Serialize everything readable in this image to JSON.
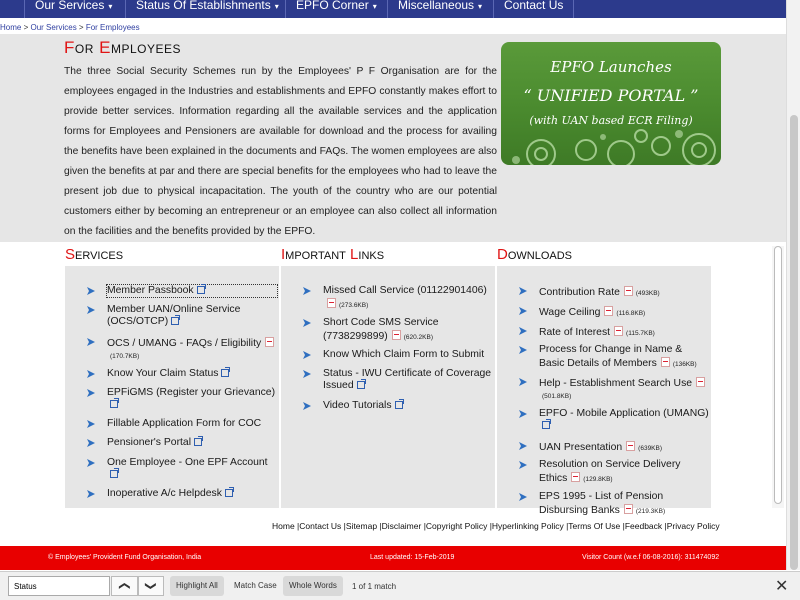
{
  "nav": {
    "items": [
      {
        "label": "Our Services",
        "caret": "▾"
      },
      {
        "label": "Status Of Establishments",
        "caret": "▾"
      },
      {
        "label": "EPFO Corner",
        "caret": "▾"
      },
      {
        "label": "Miscellaneous",
        "caret": "▾"
      },
      {
        "label": "Contact Us",
        "caret": ""
      }
    ]
  },
  "breadcrumb": {
    "home": "Home",
    "sep1": " > ",
    "services": "Our Services",
    "sep2": " > ",
    "current": "For Employees"
  },
  "page": {
    "title_f": "F",
    "title_or": "or ",
    "title_e": "E",
    "title_mployees": "mployees",
    "intro": "The three Social Security Schemes run by the Employees' P F Organisation are for the employees engaged in the Industries and establishments and EPFO constantly makes effort to provide better services. Information regarding all the available services and the application forms for Employees and Pensioners are available for download and the process for availing the benefits have been explained in the documents and FAQs. The women employees are also given the benefits at par and there are special benefits for the employees who had to leave the present job due to physical incapacitation. The youth of the country who are our potential customers either by becoming an entrepreneur or an employee can also collect all information on the facilities and the benefits provided by the EPFO."
  },
  "banner": {
    "line1": "EPFO Launches",
    "line2": "“ UNIFIED PORTAL ”",
    "line3": "(with UAN based ECR Filing)"
  },
  "sections": {
    "services": {
      "cap": "S",
      "rest": "ervices"
    },
    "links": {
      "cap1": "I",
      "rest1": "mportant ",
      "cap2": "L",
      "rest2": "inks"
    },
    "downloads": {
      "cap": "D",
      "rest": "ownloads"
    }
  },
  "services_items": [
    {
      "label": "Member Passbook",
      "ext": true,
      "pdf": false,
      "size": ""
    },
    {
      "label": "Member UAN/Online Service (OCS/OTCP)",
      "ext": true,
      "pdf": false,
      "size": ""
    },
    {
      "label": "OCS / UMANG - FAQs / Eligibility",
      "ext": false,
      "pdf": true,
      "size": "(170.7KB)"
    },
    {
      "label": "Know Your Claim Status",
      "ext": true,
      "pdf": false,
      "size": ""
    },
    {
      "label": "EPFiGMS (Register your Grievance)",
      "ext": true,
      "pdf": false,
      "size": ""
    },
    {
      "label": "Fillable Application Form for COC",
      "ext": false,
      "pdf": false,
      "size": ""
    },
    {
      "label": "Pensioner's Portal",
      "ext": true,
      "pdf": false,
      "size": ""
    },
    {
      "label": "One Employee - One EPF Account",
      "ext": true,
      "pdf": false,
      "size": ""
    },
    {
      "label": "Inoperative A/c Helpdesk",
      "ext": true,
      "pdf": false,
      "size": ""
    }
  ],
  "links_items": [
    {
      "label": "Missed Call Service (01122901406)",
      "ext": false,
      "pdf": true,
      "size": "(273.6KB)"
    },
    {
      "label": "Short Code SMS Service (7738299899)",
      "ext": false,
      "pdf": true,
      "size": "(620.2KB)"
    },
    {
      "label": "Know Which Claim Form to Submit",
      "ext": false,
      "pdf": false,
      "size": ""
    },
    {
      "label": "Status - IWU Certificate of Coverage Issued",
      "ext": true,
      "pdf": false,
      "size": ""
    },
    {
      "label": "Video Tutorials",
      "ext": true,
      "pdf": false,
      "size": ""
    }
  ],
  "downloads_items": [
    {
      "label": "Contribution Rate",
      "ext": false,
      "pdf": true,
      "size": "(493KB)"
    },
    {
      "label": "Wage Ceiling",
      "ext": false,
      "pdf": true,
      "size": "(116.8KB)"
    },
    {
      "label": "Rate of Interest",
      "ext": false,
      "pdf": true,
      "size": "(115.7KB)"
    },
    {
      "label": "Process for Change in Name & Basic Details of Members",
      "ext": false,
      "pdf": true,
      "size": "(136KB)"
    },
    {
      "label": "Help - Establishment Search Use",
      "ext": false,
      "pdf": true,
      "size": "(501.8KB)"
    },
    {
      "label": "EPFO - Mobile Application (UMANG)",
      "ext": true,
      "pdf": false,
      "size": ""
    },
    {
      "label": "UAN Presentation",
      "ext": false,
      "pdf": true,
      "size": "(639KB)"
    },
    {
      "label": "Resolution on Service Delivery Ethics",
      "ext": false,
      "pdf": true,
      "size": "(129.8KB)"
    },
    {
      "label": "EPS 1995 - List of Pension Disbursing Banks",
      "ext": false,
      "pdf": true,
      "size": "(219.3KB)"
    }
  ],
  "footer_links": [
    "Home",
    "Contact Us",
    "Sitemap",
    "Disclaimer",
    "Copyright Policy",
    "Hyperlinking Policy",
    "Terms Of Use",
    "Feedback",
    "Privacy Policy"
  ],
  "redbar": {
    "copyright": "© Employees' Provident Fund Organisation, India",
    "updated": "Last updated: 15-Feb-2019",
    "visitors": "Visitor Count (w.e.f 06-08-2016): 311474092"
  },
  "findbar": {
    "value": "Status",
    "highlight_all": "Highlight All",
    "match_case": "Match Case",
    "whole_words": "Whole Words",
    "match_count": "1 of 1 match",
    "up": "❮",
    "down": "❯",
    "close": "✕"
  },
  "colors": {
    "nav_bg": "#2c3a8c",
    "accent_red": "#e01414",
    "footer_red": "#e80000",
    "panel_bg": "#e6e6e6",
    "banner_green": "#4a8a2e"
  }
}
